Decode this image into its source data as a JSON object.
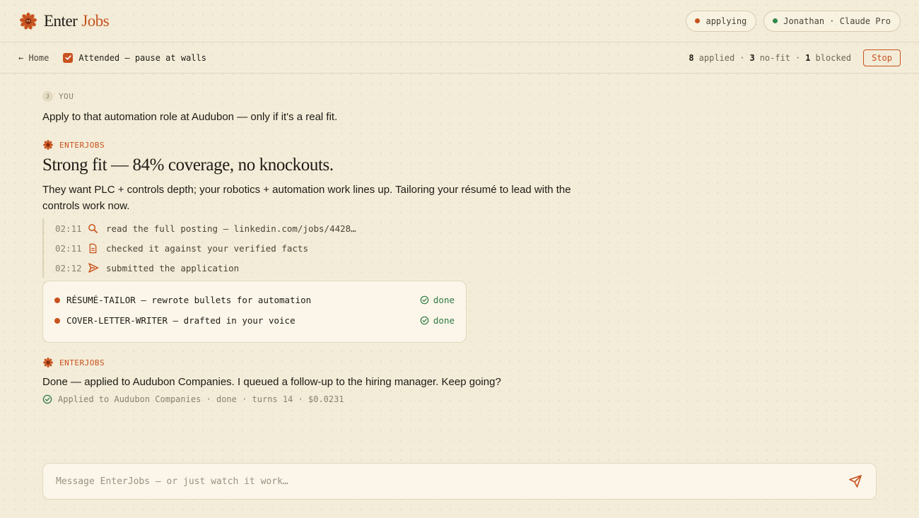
{
  "header": {
    "brand_left": "Enter",
    "brand_right": "Jobs",
    "status_pill": "applying",
    "user_pill": "Jonathan · Claude Pro"
  },
  "toolbar": {
    "home": "← Home",
    "mode": "Attended — pause at walls",
    "applied_count": "8",
    "applied_label": "applied",
    "nofit_count": "3",
    "nofit_label": "no-fit",
    "blocked_count": "1",
    "blocked_label": "blocked",
    "separator": "·",
    "stop": "Stop"
  },
  "conversation": {
    "user_avatar": "J",
    "user_label": "YOU",
    "user_message": "Apply to that automation role at Audubon — only if it's a real fit.",
    "agent_label": "ENTERJOBS",
    "headline": "Strong fit — 84% coverage, no knockouts.",
    "body": "They want PLC + controls depth; your robotics + automation work lines up. Tailoring your résumé to lead with the controls work now.",
    "timeline": [
      {
        "time": "02:11",
        "icon": "search-icon",
        "text": "read the full posting — linkedin.com/jobs/4428…"
      },
      {
        "time": "02:11",
        "icon": "document-icon",
        "text": "checked it against your verified facts"
      },
      {
        "time": "02:12",
        "icon": "send-icon",
        "text": "submitted the application"
      }
    ],
    "subagents": [
      {
        "name": "RÉSUMÉ-TAILOR — rewrote bullets for automation",
        "status": "done"
      },
      {
        "name": "COVER-LETTER-WRITER — drafted in your voice",
        "status": "done"
      }
    ],
    "final_label": "ENTERJOBS",
    "final_message": "Done — applied to Audubon Companies. I queued a follow-up to the hiring manager. Keep going?",
    "meta": "Applied to Audubon Companies · done · turns 14 · $0.0231"
  },
  "composer": {
    "placeholder": "Message EnterJobs — or just watch it work…"
  },
  "colors": {
    "accent": "#c8521e",
    "success": "#2f7a45",
    "background": "#f3ecd8"
  }
}
